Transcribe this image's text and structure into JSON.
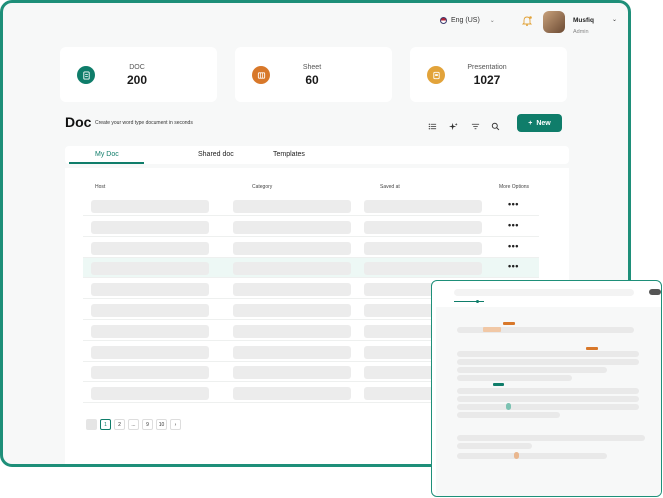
{
  "header": {
    "language": "Eng (US)",
    "user_name": "Musfiq",
    "user_role": "Admin"
  },
  "stats": [
    {
      "label": "DOC",
      "value": "200",
      "color": "#0f7d6a",
      "icon": "document-icon"
    },
    {
      "label": "Sheet",
      "value": "60",
      "color": "#d8782a",
      "icon": "sheet-icon"
    },
    {
      "label": "Presentation",
      "value": "1027",
      "color": "#e2a33a",
      "icon": "presentation-icon"
    }
  ],
  "page": {
    "title": "Doc",
    "subtitle": "Create your word type document in seconds",
    "new_button": "New"
  },
  "tabs": [
    {
      "label": "My Doc",
      "active": true
    },
    {
      "label": "Shared doc",
      "active": false
    },
    {
      "label": "Templates",
      "active": false
    }
  ],
  "table": {
    "columns": [
      "Host",
      "Category",
      "Saved at",
      "More Options"
    ],
    "row_count": 10,
    "highlighted_row": 4,
    "more_label": "•••"
  },
  "pagination": [
    "1",
    "2",
    "...",
    "9",
    "10"
  ],
  "colors": {
    "accent": "#0f7d6a",
    "frame": "#1e8f79",
    "orange": "#d8782a"
  }
}
